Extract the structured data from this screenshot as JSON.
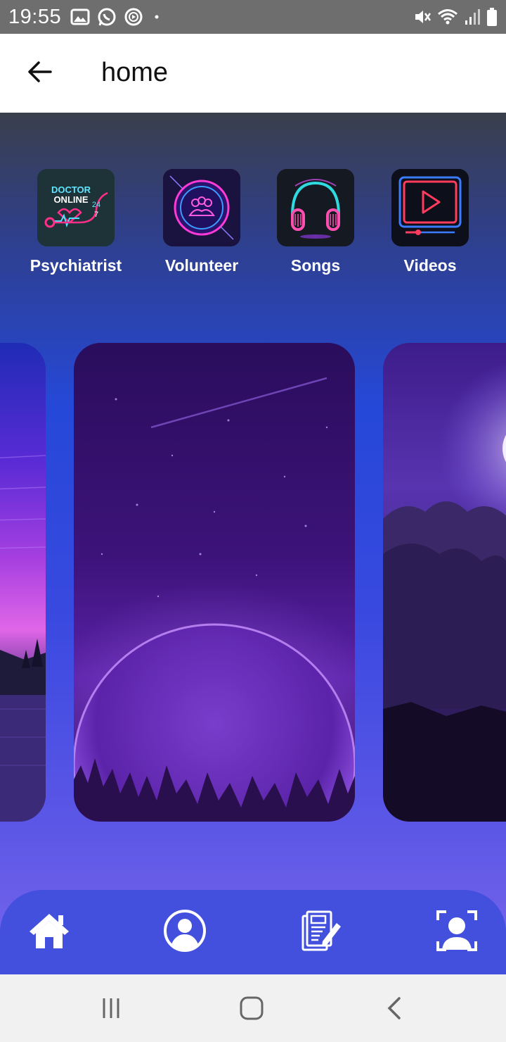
{
  "status_bar": {
    "time": "19:55",
    "left_icons": [
      "image-icon",
      "whatsapp-icon",
      "media-icon",
      "dot-icon"
    ],
    "right_icons": [
      "mute-icon",
      "wifi-icon",
      "signal-icon",
      "battery-icon"
    ]
  },
  "app_bar": {
    "title": "home",
    "back_icon": "arrow-left-icon"
  },
  "categories": [
    {
      "label": "Psychiatrist",
      "icon": "doctor-online-icon"
    },
    {
      "label": "Volunteer",
      "icon": "volunteer-group-icon"
    },
    {
      "label": "Songs",
      "icon": "headphones-icon"
    },
    {
      "label": "Videos",
      "icon": "video-player-icon"
    }
  ],
  "carousel": {
    "cards": [
      "sunset-lake-image",
      "purple-planet-image",
      "moon-clouds-image"
    ]
  },
  "bottom_nav": {
    "items": [
      "home-icon",
      "profile-icon",
      "notes-icon",
      "face-scan-icon"
    ]
  },
  "system_nav": {
    "items": [
      "recents-icon",
      "home-circle-icon",
      "back-chevron-icon"
    ]
  },
  "colors": {
    "nav_bar": "#4350dd",
    "status_bar": "#6e6e6e",
    "accent_neon": "#ff2fd0"
  }
}
